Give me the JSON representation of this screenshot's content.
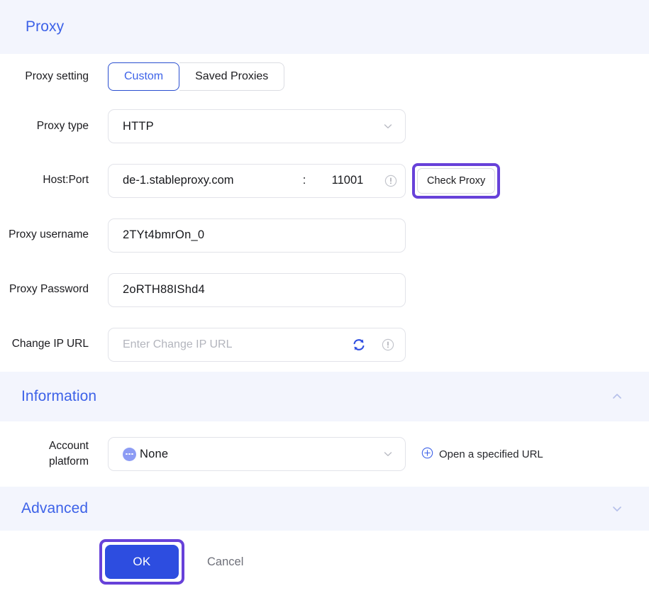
{
  "header": {
    "title": "Proxy"
  },
  "form": {
    "proxy_setting": {
      "label": "Proxy setting",
      "options": [
        "Custom",
        "Saved Proxies"
      ],
      "selected": "Custom"
    },
    "proxy_type": {
      "label": "Proxy type",
      "value": "HTTP"
    },
    "host_port": {
      "label": "Host:Port",
      "host": "de-1.stableproxy.com",
      "separator": ":",
      "port": "11001",
      "check_button": "Check Proxy"
    },
    "proxy_username": {
      "label": "Proxy username",
      "value": "2TYt4bmrOn_0"
    },
    "proxy_password": {
      "label": "Proxy Password",
      "value": "2oRTH88IShd4"
    },
    "change_ip_url": {
      "label": "Change IP URL",
      "value": "",
      "placeholder": "Enter Change IP URL"
    }
  },
  "information": {
    "title": "Information",
    "collapsed": false,
    "account_platform": {
      "label": "Account platform",
      "label_line1": "Account",
      "label_line2": "platform",
      "value": "None"
    },
    "open_url_link": "Open a specified URL"
  },
  "advanced": {
    "title": "Advanced",
    "collapsed": true
  },
  "footer": {
    "ok_label": "OK",
    "cancel_label": "Cancel"
  },
  "colors": {
    "accent_blue": "#3d62e8",
    "primary_button": "#2d4de0",
    "highlight_purple": "#6741d9",
    "band_background": "#f3f5fd",
    "platform_dot": "#8d9cf4"
  }
}
